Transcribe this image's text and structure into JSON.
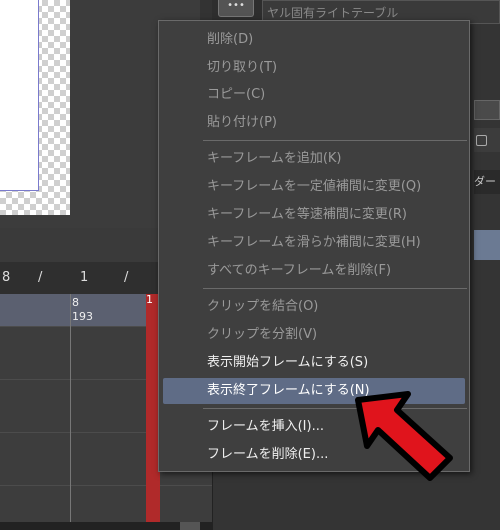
{
  "right_panel": {
    "field_text": "ヤル固有ライトテーブル",
    "side_tab_label": "ダー"
  },
  "timeline": {
    "ruler_labels": [
      "8",
      "/",
      "1",
      "/"
    ],
    "frame_labels": [
      "8",
      "193"
    ],
    "current_frame": "1"
  },
  "context_menu": {
    "items": [
      {
        "label": "削除(D)",
        "enabled": false
      },
      {
        "label": "切り取り(T)",
        "enabled": false
      },
      {
        "label": "コピー(C)",
        "enabled": false
      },
      {
        "label": "貼り付け(P)",
        "enabled": false
      },
      {
        "label": "キーフレームを追加(K)",
        "enabled": false
      },
      {
        "label": "キーフレームを一定値補間に変更(Q)",
        "enabled": false
      },
      {
        "label": "キーフレームを等速補間に変更(R)",
        "enabled": false
      },
      {
        "label": "キーフレームを滑らか補間に変更(H)",
        "enabled": false
      },
      {
        "label": "すべてのキーフレームを削除(F)",
        "enabled": false
      },
      {
        "label": "クリップを結合(O)",
        "enabled": false
      },
      {
        "label": "クリップを分割(V)",
        "enabled": false
      },
      {
        "label": "表示開始フレームにする(S)",
        "enabled": true
      },
      {
        "label": "表示終了フレームにする(N)",
        "enabled": true,
        "highlighted": true
      },
      {
        "label": "フレームを挿入(I)...",
        "enabled": true
      },
      {
        "label": "フレームを削除(E)...",
        "enabled": true
      }
    ],
    "highlight_color": "#5f6c86"
  },
  "annotation": {
    "arrow_color": "#e0141c",
    "arrow_outline": "#000000",
    "icon": "red-pointer-arrow"
  },
  "icons": {
    "panel_menu": "menu-icon"
  }
}
